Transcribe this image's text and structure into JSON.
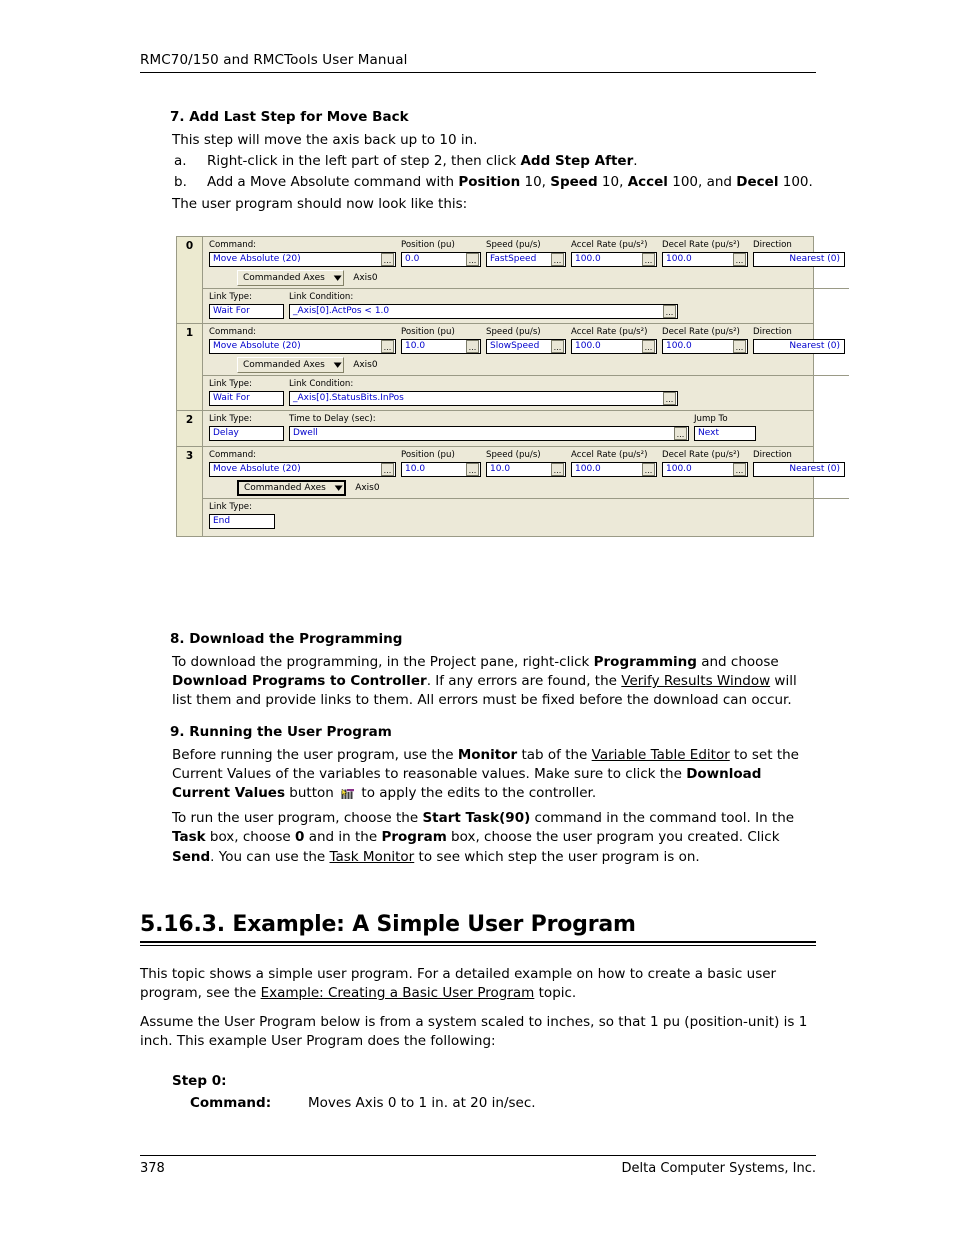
{
  "header": {
    "title": "RMC70/150 and RMCTools User Manual"
  },
  "section7": {
    "heading": "7. Add Last Step for Move Back",
    "intro": "This step will move the axis back up to 10 in.",
    "items": [
      {
        "marker": "a.",
        "parts": [
          {
            "t": "Right-click in the left part of step 2, then click ",
            "b": false
          },
          {
            "t": "Add Step After",
            "b": true
          },
          {
            "t": ".",
            "b": false
          }
        ]
      },
      {
        "marker": "b.",
        "parts": [
          {
            "t": "Add a Move Absolute command with ",
            "b": false
          },
          {
            "t": "Position",
            "b": true
          },
          {
            "t": " 10, ",
            "b": false
          },
          {
            "t": "Speed",
            "b": true
          },
          {
            "t": " 10, ",
            "b": false
          },
          {
            "t": "Accel",
            "b": true
          },
          {
            "t": " 100, and ",
            "b": false
          },
          {
            "t": "Decel",
            "b": true
          },
          {
            "t": " 100.",
            "b": false
          }
        ]
      }
    ],
    "outro": "The user program should now look like this:"
  },
  "program_editor": {
    "labels": {
      "command": "Command:",
      "position": "Position (pu)",
      "speed": "Speed (pu/s)",
      "accel": "Accel Rate (pu/s²)",
      "decel": "Decel Rate (pu/s²)",
      "direction": "Direction",
      "link_type": "Link Type:",
      "link_condition": "Link Condition:",
      "time_to_delay": "Time to Delay (sec):",
      "jump_to": "Jump To",
      "axes_dropdown": "Commanded Axes",
      "axis_name": "Axis0",
      "ellipsis": "..."
    },
    "steps": [
      {
        "number": "0",
        "kind": "command",
        "command": "Move Absolute (20)",
        "position": "0.0",
        "speed": "FastSpeed",
        "accel": "100.0",
        "decel": "100.0",
        "direction": "Nearest (0)",
        "axes": "Commanded Axes",
        "axis": "Axis0",
        "axes_focused": false,
        "link_type": "Wait For",
        "link_condition": "_Axis[0].ActPos < 1.0"
      },
      {
        "number": "1",
        "kind": "command",
        "command": "Move Absolute (20)",
        "position": "10.0",
        "speed": "SlowSpeed",
        "accel": "100.0",
        "decel": "100.0",
        "direction": "Nearest (0)",
        "axes": "Commanded Axes",
        "axis": "Axis0",
        "axes_focused": false,
        "link_type": "Wait For",
        "link_condition": "_Axis[0].StatusBits.InPos"
      },
      {
        "number": "2",
        "kind": "delay",
        "link_type": "Delay",
        "time_to_delay": "Dwell",
        "jump_to": "Next"
      },
      {
        "number": "3",
        "kind": "command-end",
        "command": "Move Absolute (20)",
        "position": "10.0",
        "speed": "10.0",
        "accel": "100.0",
        "decel": "100.0",
        "direction": "Nearest (0)",
        "axes": "Commanded Axes",
        "axis": "Axis0",
        "axes_focused": true,
        "link_type": "End"
      }
    ],
    "colors": {
      "field_text": "#0000cc",
      "panel_bg": "#ece9d8",
      "step_number_bg": "#ecead0"
    }
  },
  "section8": {
    "heading": "8. Download the Programming",
    "parts": [
      {
        "t": "To download the programming, in the Project pane, right-click ",
        "b": false
      },
      {
        "t": "Programming",
        "b": true
      },
      {
        "t": " and choose ",
        "b": false
      },
      {
        "t": "Download Programs to Controller",
        "b": true
      },
      {
        "t": ". If any errors are found, the ",
        "b": false
      },
      {
        "t": "Verify Results Window",
        "u": true
      },
      {
        "t": " will list them and provide links to them. All errors must be fixed before the download can occur.",
        "b": false
      }
    ]
  },
  "section9": {
    "heading": "9. Running the User Program",
    "para1_parts": [
      {
        "t": "Before running the user program, use the ",
        "b": false
      },
      {
        "t": "Monitor",
        "b": true
      },
      {
        "t": " tab of the ",
        "b": false
      },
      {
        "t": "Variable Table Editor",
        "u": true
      },
      {
        "t": " to set the Current Values of the variables to reasonable values. Make sure to click the ",
        "b": false
      },
      {
        "t": "Download Current Values",
        "b": true
      },
      {
        "t": " button ",
        "b": false
      },
      {
        "t": "[download-current-values-icon]",
        "icon": true
      },
      {
        "t": " to apply the edits to the controller.",
        "b": false
      }
    ],
    "para2_parts": [
      {
        "t": "To run the user program, choose the ",
        "b": false
      },
      {
        "t": "Start Task(90)",
        "b": true
      },
      {
        "t": " command in the command tool. In the ",
        "b": false
      },
      {
        "t": "Task",
        "b": true
      },
      {
        "t": " box, choose ",
        "b": false
      },
      {
        "t": "0",
        "b": true
      },
      {
        "t": " and in the ",
        "b": false
      },
      {
        "t": "Program",
        "b": true
      },
      {
        "t": " box, choose the user program you created. Click ",
        "b": false
      },
      {
        "t": "Send",
        "b": true
      },
      {
        "t": ". You can use the ",
        "b": false
      },
      {
        "t": "Task Monitor",
        "u": true
      },
      {
        "t": " to see which step the user program is on.",
        "b": false
      }
    ]
  },
  "section_5163": {
    "heading": "5.16.3. Example: A Simple User Program",
    "para1_parts": [
      {
        "t": "This topic shows a simple user program. For a detailed example on how to create a basic user program, see the ",
        "b": false
      },
      {
        "t": "Example: Creating a Basic User Program",
        "u": true
      },
      {
        "t": " topic.",
        "b": false
      }
    ],
    "para2": "Assume the User Program below is from a system scaled to inches, so that 1 pu (position-unit) is 1 inch. This example User Program does the following:",
    "step0_title": "Step 0:",
    "command_key": "Command:",
    "command_value": "Moves Axis 0 to 1 in. at 20 in/sec."
  },
  "footer": {
    "page_number": "378",
    "company": "Delta Computer Systems, Inc."
  }
}
